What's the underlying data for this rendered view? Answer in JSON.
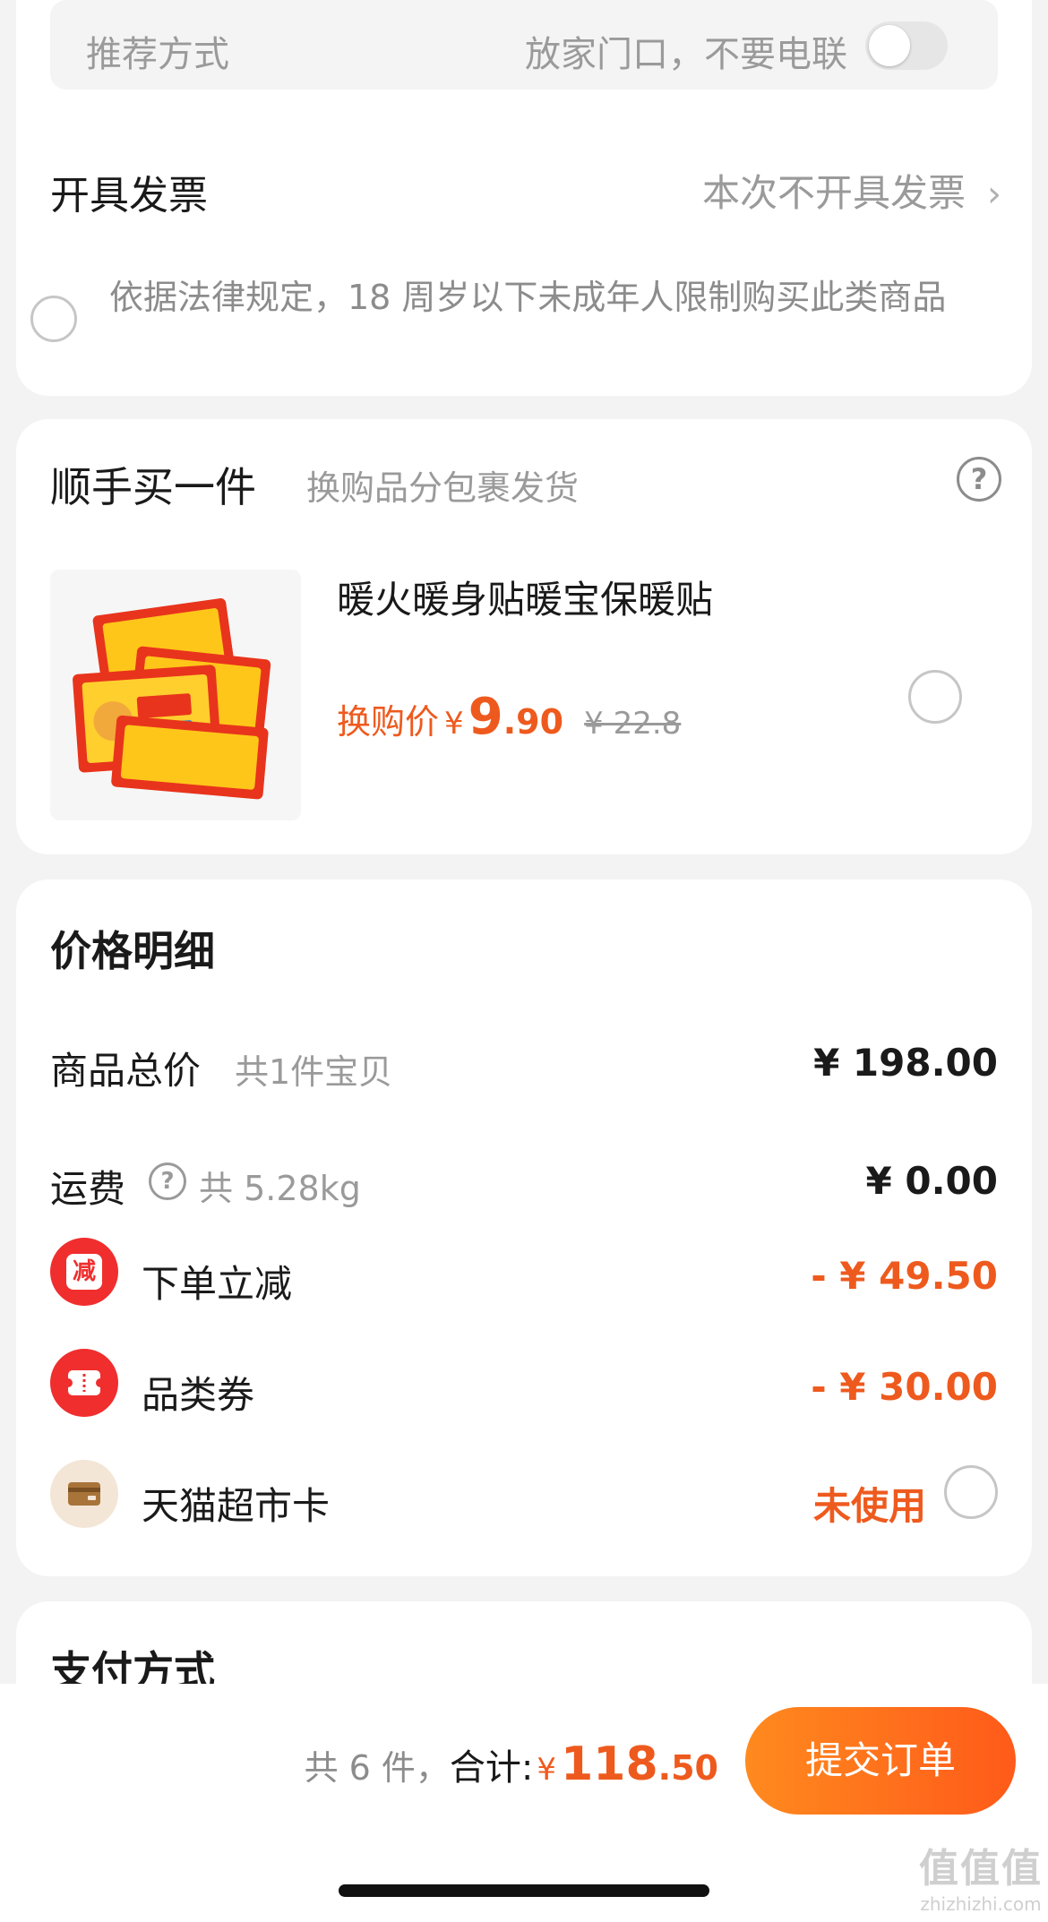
{
  "delivery": {
    "label": "推荐方式",
    "value": "放家门口，不要电联",
    "toggle_on": false
  },
  "invoice": {
    "label": "开具发票",
    "value": "本次不开具发票"
  },
  "legal_notice": "依据法律规定，18 周岁以下未成年人限制购买此类商品",
  "addon": {
    "title": "顺手买一件",
    "subtitle": "换购品分包裹发货",
    "product_name": "暖火暖身贴暖宝保暖贴",
    "price_label": "换购价",
    "currency": "¥",
    "price_int": "9",
    "price_dec": ".90",
    "original_price": "¥ 22.8"
  },
  "price_detail": {
    "title": "价格明细",
    "goods_label": "商品总价",
    "goods_count": "共1件宝贝",
    "goods_value": "¥ 198.00",
    "shipping_label": "运费",
    "shipping_weight": "共 5.28kg",
    "shipping_value": "¥ 0.00",
    "instant_label": "下单立减",
    "instant_icon_text": "减",
    "instant_value": "- ¥ 49.50",
    "coupon_label": "品类券",
    "coupon_value": "- ¥ 30.00",
    "card_label": "天猫超市卡",
    "card_value": "未使用"
  },
  "payment": {
    "title": "支付方式"
  },
  "footer": {
    "count": "共 6 件，",
    "total_label": "合计:",
    "currency": "¥",
    "total_int": "118",
    "total_dec": ".50",
    "submit": "提交订单"
  },
  "watermark": {
    "logo": "值值值",
    "domain": "zhizhizhi.com"
  },
  "colors": {
    "accent": "#ee5a1e",
    "button_start": "#ff8a1e",
    "button_end": "#ff5a1a",
    "badge_red": "#f02e2e"
  }
}
